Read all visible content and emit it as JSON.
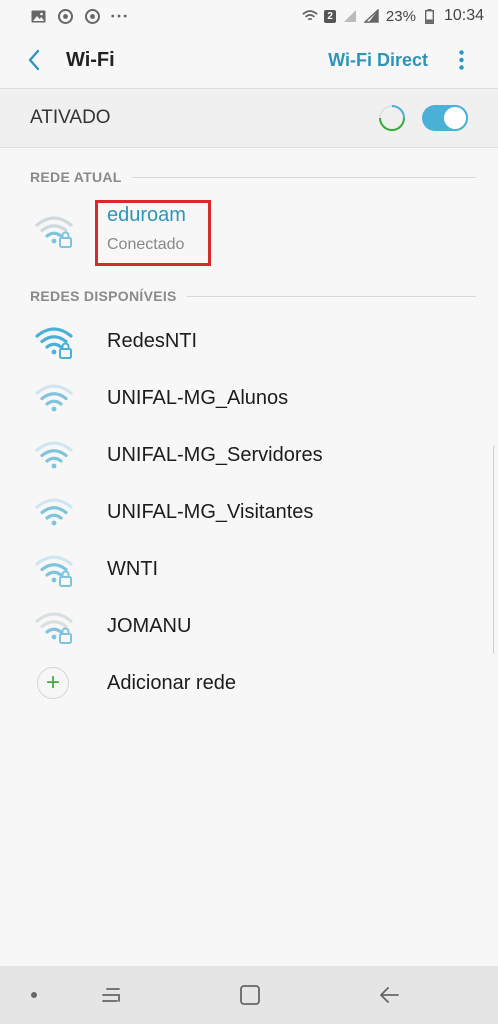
{
  "status_bar": {
    "left_icons": [
      "gallery-icon",
      "chrome-icon",
      "chrome-icon",
      "more-dots-icon"
    ],
    "badge": "2",
    "battery": "23%",
    "time": "10:34"
  },
  "app_bar": {
    "title": "Wi-Fi",
    "action": "Wi-Fi Direct"
  },
  "master": {
    "label": "ATIVADO",
    "enabled": true
  },
  "current_section": {
    "header": "REDE ATUAL",
    "network": {
      "name": "eduroam",
      "status": "Conectado",
      "secured": true,
      "highlighted": true
    }
  },
  "available_section": {
    "header": "REDES DISPONÍVEIS",
    "networks": [
      {
        "name": "RedesNTI",
        "secured": true,
        "strength": "strong"
      },
      {
        "name": "UNIFAL-MG_Alunos",
        "secured": false,
        "strength": "medium"
      },
      {
        "name": "UNIFAL-MG_Servidores",
        "secured": false,
        "strength": "medium"
      },
      {
        "name": "UNIFAL-MG_Visitantes",
        "secured": false,
        "strength": "medium"
      },
      {
        "name": "WNTI",
        "secured": true,
        "strength": "medium"
      },
      {
        "name": "JOMANU",
        "secured": true,
        "strength": "weak"
      }
    ],
    "add_network": "Adicionar rede"
  },
  "colors": {
    "accent": "#2e95b8",
    "toggle": "#4bb0d8",
    "add_plus": "#3cab3c",
    "highlight_border": "#d42b2b"
  }
}
